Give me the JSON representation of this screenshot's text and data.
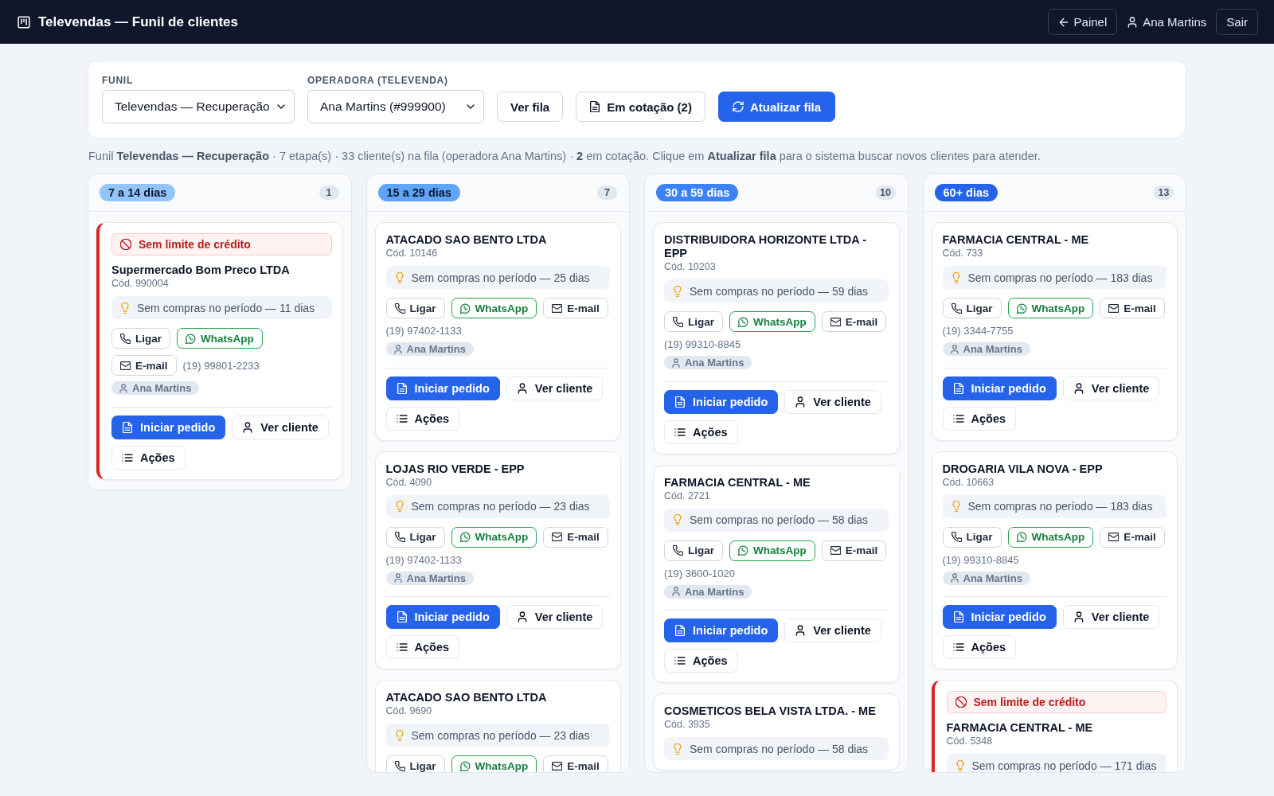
{
  "header": {
    "title": "Televendas — Funil de clientes",
    "back_button": "Painel",
    "user": "Ana Martins",
    "logout_button": "Sair"
  },
  "filters": {
    "fields": [
      {
        "label": "FUNIL",
        "value": "Televendas — Recuperação"
      },
      {
        "label": "OPERADORA (TELEVENDA)",
        "value": "Ana Martins (#999900)"
      }
    ],
    "buttons": [
      {
        "kind": "plain",
        "label": "Ver fila"
      },
      {
        "kind": "quote",
        "label": "Em cotação (2)"
      },
      {
        "kind": "refresh",
        "label": "Atualizar fila"
      }
    ]
  },
  "summary": "Funil **Televendas — Recuperação** · 7 etapa(s) · 33 cliente(s) na fila (operadora Ana Martins) · **2** em cotação. Clique em **Atualizar fila** para o sistema buscar novos clientes para atender.",
  "columns": [
    {
      "title": "7 a 14 dias",
      "count": "1",
      "color": "#93c5fd",
      "cards": [
        {
          "blocked": true,
          "alert": "Sem limite de crédito",
          "name": "Supermercado Bom Preco LTDA",
          "code": "Cód. 990004",
          "note": "Sem compras no período — 11 dias",
          "contacts": [
            {
              "kind": "call",
              "label": "Ligar"
            },
            {
              "kind": "whatsapp",
              "label": "WhatsApp"
            },
            {
              "kind": "email",
              "label": "E-mail"
            }
          ],
          "phone": "(19) 99801-2233",
          "owner": "Ana Martins",
          "actions": [
            {
              "kind": "order",
              "label": "Iniciar pedido"
            },
            {
              "kind": "view",
              "label": "Ver cliente"
            },
            {
              "kind": "menu",
              "label": "Ações"
            }
          ]
        }
      ]
    },
    {
      "title": "15 a 29 dias",
      "count": "7",
      "color": "#60a5fa",
      "cards": [
        {
          "blocked": false,
          "name": "ATACADO SAO BENTO LTDA",
          "code": "Cód. 10146",
          "note": "Sem compras no período — 25 dias",
          "contacts": [
            {
              "kind": "call",
              "label": "Ligar"
            },
            {
              "kind": "whatsapp",
              "label": "WhatsApp"
            },
            {
              "kind": "email",
              "label": "E-mail"
            }
          ],
          "phone": "(19) 97402-1133",
          "owner": "Ana Martins",
          "actions": [
            {
              "kind": "order",
              "label": "Iniciar pedido"
            },
            {
              "kind": "view",
              "label": "Ver cliente"
            },
            {
              "kind": "menu",
              "label": "Ações"
            }
          ]
        },
        {
          "blocked": false,
          "name": "LOJAS RIO VERDE - EPP",
          "code": "Cód. 4090",
          "note": "Sem compras no período — 23 dias",
          "contacts": [
            {
              "kind": "call",
              "label": "Ligar"
            },
            {
              "kind": "whatsapp",
              "label": "WhatsApp"
            },
            {
              "kind": "email",
              "label": "E-mail"
            }
          ],
          "phone": "(19) 97402-1133",
          "owner": "Ana Martins",
          "actions": [
            {
              "kind": "order",
              "label": "Iniciar pedido"
            },
            {
              "kind": "view",
              "label": "Ver cliente"
            },
            {
              "kind": "menu",
              "label": "Ações"
            }
          ]
        },
        {
          "blocked": false,
          "name": "ATACADO SAO BENTO LTDA",
          "code": "Cód. 9690",
          "note": "Sem compras no período — 23 dias",
          "contacts": [
            {
              "kind": "call",
              "label": "Ligar"
            },
            {
              "kind": "whatsapp",
              "label": "WhatsApp"
            },
            {
              "kind": "email",
              "label": "E-mail"
            }
          ]
        }
      ]
    },
    {
      "title": "30 a 59 dias",
      "count": "10",
      "color": "#3b82f6",
      "cards": [
        {
          "blocked": false,
          "name": "DISTRIBUIDORA HORIZONTE LTDA - EPP",
          "code": "Cód. 10203",
          "note": "Sem compras no período — 59 dias",
          "contacts": [
            {
              "kind": "call",
              "label": "Ligar"
            },
            {
              "kind": "whatsapp",
              "label": "WhatsApp"
            },
            {
              "kind": "email",
              "label": "E-mail"
            }
          ],
          "phone": "(19) 99310-8845",
          "owner": "Ana Martins",
          "actions": [
            {
              "kind": "order",
              "label": "Iniciar pedido"
            },
            {
              "kind": "view",
              "label": "Ver cliente"
            },
            {
              "kind": "menu",
              "label": "Ações"
            }
          ]
        },
        {
          "blocked": false,
          "name": "FARMACIA CENTRAL - ME",
          "code": "Cód. 2721",
          "note": "Sem compras no período — 58 dias",
          "contacts": [
            {
              "kind": "call",
              "label": "Ligar"
            },
            {
              "kind": "whatsapp",
              "label": "WhatsApp"
            },
            {
              "kind": "email",
              "label": "E-mail"
            }
          ],
          "phone": "(19) 3600-1020",
          "owner": "Ana Martins",
          "actions": [
            {
              "kind": "order",
              "label": "Iniciar pedido"
            },
            {
              "kind": "view",
              "label": "Ver cliente"
            },
            {
              "kind": "menu",
              "label": "Ações"
            }
          ]
        },
        {
          "blocked": false,
          "name": "COSMETICOS BELA VISTA LTDA. - ME",
          "code": "Cód. 3935",
          "note": "Sem compras no período — 58 dias"
        }
      ]
    },
    {
      "title": "60+ dias",
      "count": "13",
      "color": "#2563eb",
      "cards": [
        {
          "blocked": false,
          "name": "FARMACIA CENTRAL - ME",
          "code": "Cód. 733",
          "note": "Sem compras no período — 183 dias",
          "contacts": [
            {
              "kind": "call",
              "label": "Ligar"
            },
            {
              "kind": "whatsapp",
              "label": "WhatsApp"
            },
            {
              "kind": "email",
              "label": "E-mail"
            }
          ],
          "phone": "(19) 3344-7755",
          "owner": "Ana Martins",
          "actions": [
            {
              "kind": "order",
              "label": "Iniciar pedido"
            },
            {
              "kind": "view",
              "label": "Ver cliente"
            },
            {
              "kind": "menu",
              "label": "Ações"
            }
          ]
        },
        {
          "blocked": false,
          "name": "DROGARIA VILA NOVA - EPP",
          "code": "Cód. 10663",
          "note": "Sem compras no período — 183 dias",
          "contacts": [
            {
              "kind": "call",
              "label": "Ligar"
            },
            {
              "kind": "whatsapp",
              "label": "WhatsApp"
            },
            {
              "kind": "email",
              "label": "E-mail"
            }
          ],
          "phone": "(19) 99310-8845",
          "owner": "Ana Martins",
          "actions": [
            {
              "kind": "order",
              "label": "Iniciar pedido"
            },
            {
              "kind": "view",
              "label": "Ver cliente"
            },
            {
              "kind": "menu",
              "label": "Ações"
            }
          ]
        },
        {
          "blocked": true,
          "alert": "Sem limite de crédito",
          "name": "FARMACIA CENTRAL - ME",
          "code": "Cód. 5348",
          "note": "Sem compras no período — 171 dias"
        }
      ]
    }
  ]
}
